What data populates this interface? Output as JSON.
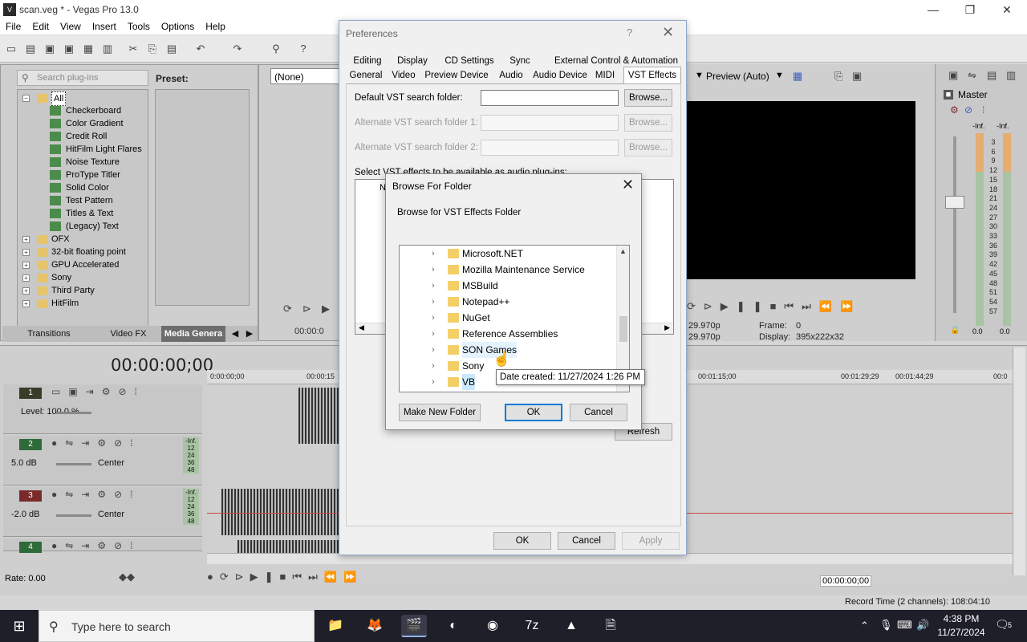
{
  "window": {
    "title": "scan.veg * - Vegas Pro 13.0",
    "minimize": "—",
    "maximize": "❐",
    "close": "✕"
  },
  "menu": [
    "File",
    "Edit",
    "View",
    "Insert",
    "Tools",
    "Options",
    "Help"
  ],
  "plugin_panel": {
    "search_placeholder": "Search plug-ins",
    "preset_label": "Preset:",
    "tree": [
      {
        "label": "All",
        "level": 0,
        "type": "folder",
        "expander": "−",
        "selected": true
      },
      {
        "label": "Checkerboard",
        "level": 1,
        "type": "plugin"
      },
      {
        "label": "Color Gradient",
        "level": 1,
        "type": "plugin"
      },
      {
        "label": "Credit Roll",
        "level": 1,
        "type": "plugin"
      },
      {
        "label": "HitFilm Light Flares",
        "level": 1,
        "type": "plugin"
      },
      {
        "label": "Noise Texture",
        "level": 1,
        "type": "plugin"
      },
      {
        "label": "ProType Titler",
        "level": 1,
        "type": "plugin"
      },
      {
        "label": "Solid Color",
        "level": 1,
        "type": "plugin"
      },
      {
        "label": "Test Pattern",
        "level": 1,
        "type": "plugin"
      },
      {
        "label": "Titles & Text",
        "level": 1,
        "type": "plugin"
      },
      {
        "label": "(Legacy) Text",
        "level": 1,
        "type": "plugin"
      },
      {
        "label": "OFX",
        "level": 0,
        "type": "folder",
        "expander": "+"
      },
      {
        "label": "32-bit floating point",
        "level": 0,
        "type": "folder",
        "expander": "+"
      },
      {
        "label": "GPU Accelerated",
        "level": 0,
        "type": "folder",
        "expander": "+"
      },
      {
        "label": "Sony",
        "level": 0,
        "type": "folder",
        "expander": "+"
      },
      {
        "label": "Third Party",
        "level": 0,
        "type": "folder",
        "expander": "+"
      },
      {
        "label": "HitFilm",
        "level": 0,
        "type": "folder",
        "expander": "+"
      }
    ],
    "tabs": [
      "Transitions",
      "Video FX",
      "Media Genera"
    ]
  },
  "trimmer": {
    "select_value": "(None)",
    "timecode": "00:00:0"
  },
  "preview": {
    "label": "Preview (Auto)",
    "fps1": "29.970p",
    "fps2": "29.970p",
    "frame_label": "Frame:",
    "frame_value": "0",
    "display_label": "Display:",
    "display_value": "395x222x32"
  },
  "master": {
    "label": "Master",
    "left_inf": "-Inf.",
    "right_inf": "-Inf.",
    "scale": [
      "3",
      "6",
      "9",
      "12",
      "15",
      "18",
      "21",
      "24",
      "27",
      "30",
      "33",
      "36",
      "39",
      "42",
      "45",
      "48",
      "51",
      "54",
      "57"
    ],
    "bottom_left": "0.0",
    "bottom_right": "0.0"
  },
  "timeline": {
    "timecode": "00:00:00;00",
    "ruler": [
      "0:00:00;00",
      "00:00:15",
      "00:01:15;00",
      "00:01:29;29",
      "00:01:44;29",
      "00:0"
    ],
    "tracks": [
      {
        "num": "1",
        "color": "#3b3b2a",
        "text1": "Level: 100.0 %",
        "text2": ""
      },
      {
        "num": "2",
        "color": "#2f6a3a",
        "text1": "5.0 dB",
        "text2": "Center"
      },
      {
        "num": "3",
        "color": "#7a2a2a",
        "text1": "-2.0 dB",
        "text2": "Center"
      },
      {
        "num": "4",
        "color": "#2f6a3a",
        "text1": "",
        "text2": ""
      }
    ],
    "meter_labels": [
      "12",
      "24",
      "36",
      "48"
    ],
    "inf_label": "-Inf.",
    "rate": "Rate: 0.00",
    "transport_timecode": "00:00:00;00",
    "record_time": "Record Time (2 channels): 108:04:10"
  },
  "preferences": {
    "title": "Preferences",
    "help": "?",
    "close": "✕",
    "tabs_row1": [
      "Editing",
      "Display",
      "CD Settings",
      "Sync",
      "External Control & Automation"
    ],
    "tabs_row2": [
      "General",
      "Video",
      "Preview Device",
      "Audio",
      "Audio Device",
      "MIDI",
      "VST Effects"
    ],
    "default_label": "Default VST search folder:",
    "alt1_label": "Alternate VST search folder 1:",
    "alt2_label": "Alternate VST search folder 2:",
    "default_value": "",
    "browse": "Browse...",
    "select_label": "Select VST effects to be available as audio plug-ins:",
    "list_header": "N",
    "refresh": "Refresh",
    "ok": "OK",
    "cancel": "Cancel",
    "apply": "Apply"
  },
  "browse_dialog": {
    "title": "Browse For Folder",
    "close": "✕",
    "subtitle": "Browse for VST Effects Folder",
    "folders": [
      "Microsoft.NET",
      "Mozilla Maintenance Service",
      "MSBuild",
      "Notepad++",
      "NuGet",
      "Reference Assemblies",
      "SON Games",
      "Sony",
      "VB"
    ],
    "hover_index": 6,
    "selected_index": 8,
    "tooltip": "Date created: 11/27/2024 1:26 PM",
    "make_new_folder": "Make New Folder",
    "ok": "OK",
    "cancel": "Cancel"
  },
  "taskbar": {
    "search_placeholder": "Type here to search",
    "apps": [
      "file-explorer-icon",
      "firefox-icon",
      "vegas-icon",
      "edge-icon",
      "obs-icon",
      "7zip-icon",
      "vlc-icon",
      "archive-icon"
    ],
    "app_glyphs": [
      "📁",
      "🦊",
      "🎬",
      "◐",
      "◉",
      "7z",
      "▲",
      "🗎"
    ],
    "time": "4:38 PM",
    "date": "11/27/2024",
    "notifications": "5"
  }
}
